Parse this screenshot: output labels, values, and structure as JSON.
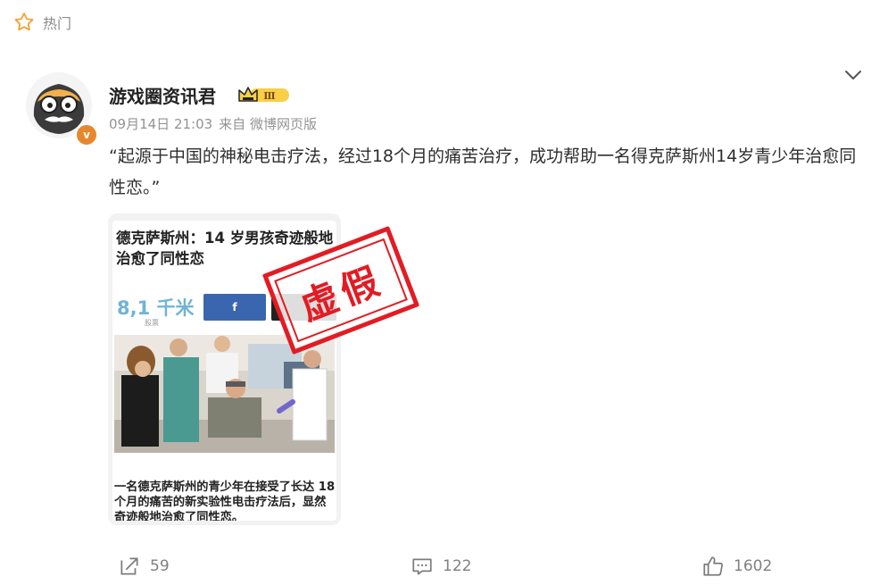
{
  "hot": {
    "label": "热门",
    "icon": "star-outline-icon"
  },
  "post": {
    "author": "游戏圈资讯君",
    "vip_level": "Ⅲ",
    "verified_mark": "v",
    "date": "09月14日 21:03",
    "source": "来自 微博网页版",
    "text": "“起源于中国的神秘电击疗法，经过18个月的痛苦治疗，成功帮助一名得克萨斯州14岁青少年治愈同性恋。”"
  },
  "image_card": {
    "headline": "德克萨斯州：14 岁男孩奇迹般地治愈了同性恋",
    "count": "8,1 千米",
    "count_sub": "股票",
    "fb_label": "f",
    "caption": "一名德克萨斯州的青少年在接受了长达 18 个月的痛苦的新实验性电击疗法后，显然奇迹般地治愈了同性恋。",
    "stamp": "虚假"
  },
  "actions": {
    "share_count": "59",
    "comment_count": "122",
    "like_count": "1602"
  },
  "colors": {
    "stamp_red": "#e21c24",
    "muted_gray": "#8a8a8a",
    "badge_orange": "#e8862e",
    "fb_blue": "#3a66b0"
  }
}
